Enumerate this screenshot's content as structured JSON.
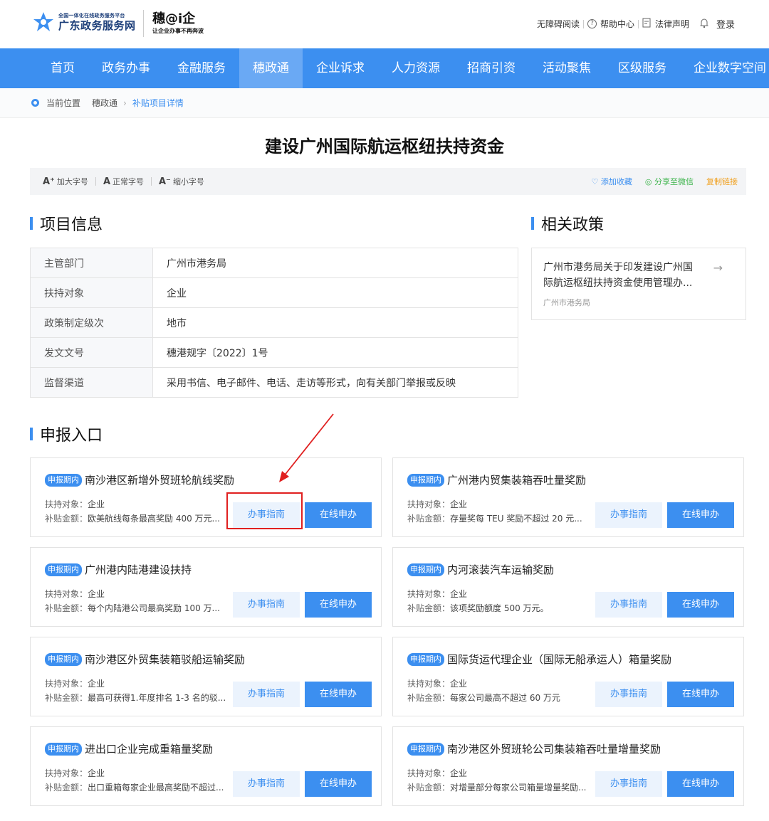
{
  "header": {
    "logo_small": "全国一体化在线政务服务平台",
    "logo_big": "广东政务服务网",
    "logo2_big": "穗@i企",
    "logo2_small": "让企业办事不再奔波",
    "links": {
      "accessible": "无障碍阅读",
      "help": "帮助中心",
      "legal": "法律声明",
      "login": "登录"
    }
  },
  "nav": {
    "items": [
      "首页",
      "政务办事",
      "金融服务",
      "穗政通",
      "企业诉求",
      "人力资源",
      "招商引资",
      "活动聚焦",
      "区级服务",
      "企业数字空间"
    ],
    "active_index": 3
  },
  "breadcrumb": {
    "label": "当前位置",
    "level1": "穗政通",
    "current": "补贴项目详情"
  },
  "page_title": "建设广州国际航运枢纽扶持资金",
  "toolbar": {
    "larger": "加大字号",
    "normal": "正常字号",
    "smaller": "缩小字号",
    "favorite": "添加收藏",
    "share": "分享至微信",
    "copy": "复制链接"
  },
  "project_info": {
    "title": "项目信息",
    "rows": [
      {
        "key": "主管部门",
        "value": "广州市港务局"
      },
      {
        "key": "扶持对象",
        "value": "企业"
      },
      {
        "key": "政策制定级次",
        "value": "地市"
      },
      {
        "key": "发文文号",
        "value": "穗港规字〔2022〕1号"
      },
      {
        "key": "监督渠道",
        "value": "采用书信、电子邮件、电话、走访等形式，向有关部门举报或反映"
      }
    ]
  },
  "related_policy": {
    "title": "相关政策",
    "item_title": "广州市港务局关于印发建设广州国际航运枢纽扶持资金使用管理办...",
    "item_source": "广州市港务局"
  },
  "apply": {
    "title": "申报入口",
    "badge": "申报期内",
    "target_label": "扶持对象：",
    "amount_label": "补贴金额：",
    "guide_label": "办事指南",
    "apply_label": "在线申办",
    "cards": [
      {
        "title": "南沙港区新增外贸班轮航线奖励",
        "target": "企业",
        "amount": "欧美航线每条最高奖励 400 万元..."
      },
      {
        "title": "广州港内贸集装箱吞吐量奖励",
        "target": "企业",
        "amount": "存量奖每 TEU 奖励不超过 20 元..."
      },
      {
        "title": "广州港内陆港建设扶持",
        "target": "企业",
        "amount": "每个内陆港公司最高奖励 100 万..."
      },
      {
        "title": "内河滚装汽车运输奖励",
        "target": "企业",
        "amount": "该项奖励额度 500 万元。"
      },
      {
        "title": "南沙港区外贸集装箱驳船运输奖励",
        "target": "企业",
        "amount": "最高可获得1.年度排名 1-3 名的驳..."
      },
      {
        "title": "国际货运代理企业（国际无船承运人）箱量奖励",
        "target": "企业",
        "amount": "每家公司最高不超过 60 万元"
      },
      {
        "title": "进出口企业完成重箱量奖励",
        "target": "企业",
        "amount": "出口重箱每家企业最高奖励不超过..."
      },
      {
        "title": "南沙港区外贸班轮公司集装箱吞吐量增量奖励",
        "target": "企业",
        "amount": "对增量部分每家公司箱量增量奖励..."
      }
    ]
  },
  "colors": {
    "primary": "#3c8ff0",
    "nav_active": "#6aa9f4",
    "annotation": "#e02020"
  }
}
